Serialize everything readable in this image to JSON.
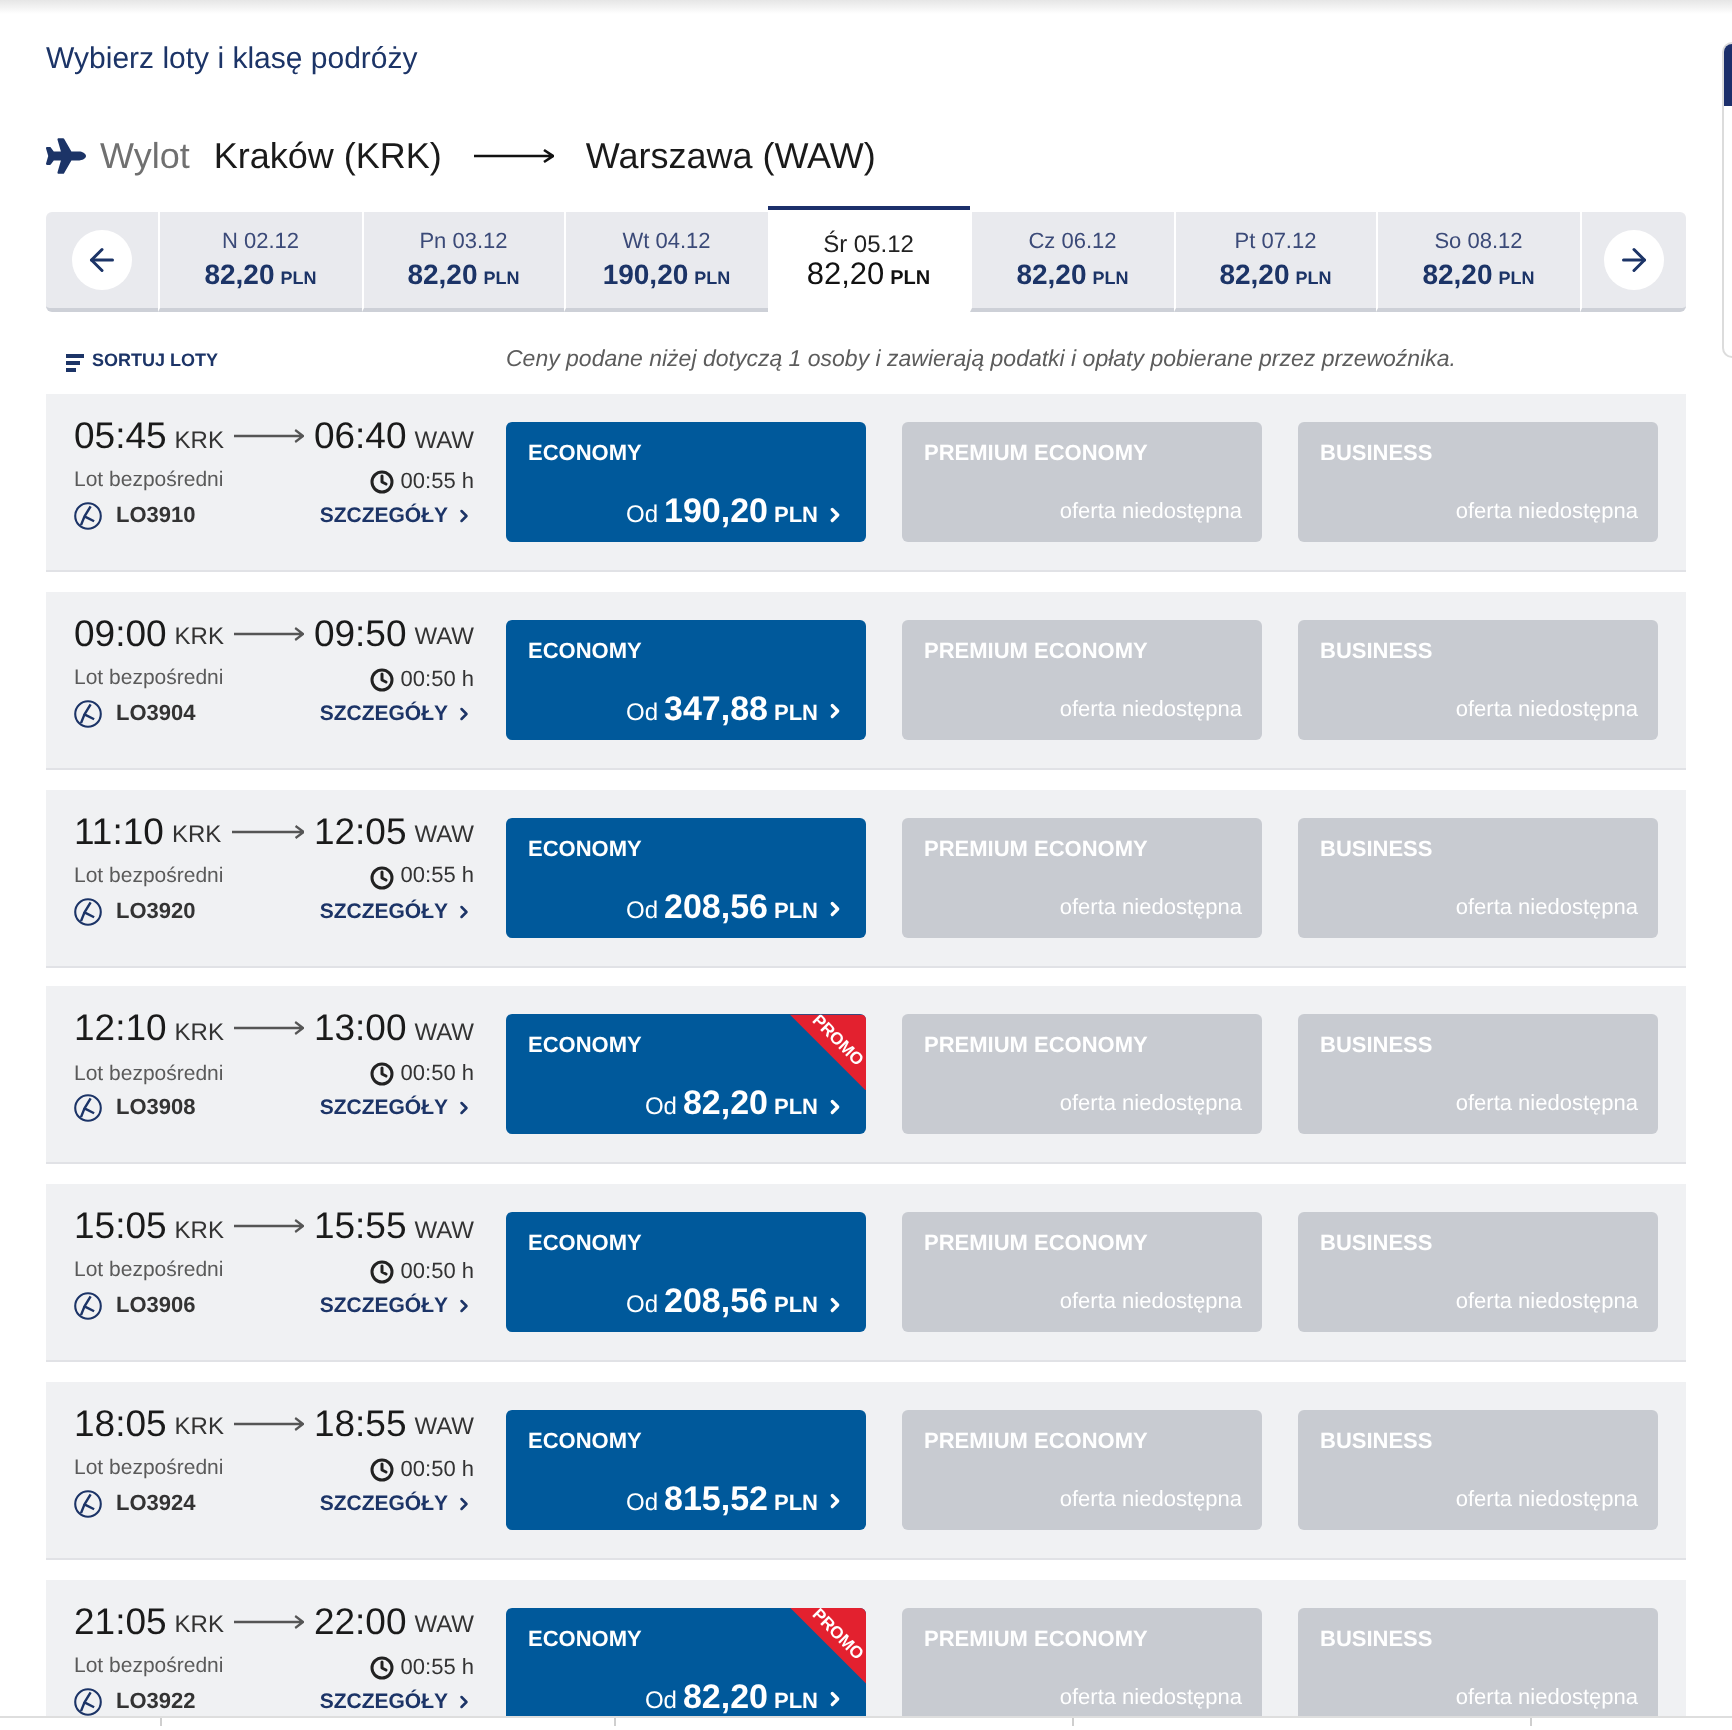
{
  "heading": "Wybierz loty i klasę podróży",
  "route": {
    "label": "Wylot",
    "origin": "Kraków (KRK)",
    "destination": "Warszawa (WAW)"
  },
  "dates": [
    {
      "day": "N 02.12",
      "price": "82,20",
      "currency": "PLN",
      "selected": false
    },
    {
      "day": "Pn 03.12",
      "price": "82,20",
      "currency": "PLN",
      "selected": false
    },
    {
      "day": "Wt 04.12",
      "price": "190,20",
      "currency": "PLN",
      "selected": false
    },
    {
      "day": "Śr 05.12",
      "price": "82,20",
      "currency": "PLN",
      "selected": true
    },
    {
      "day": "Cz 06.12",
      "price": "82,20",
      "currency": "PLN",
      "selected": false
    },
    {
      "day": "Pt 07.12",
      "price": "82,20",
      "currency": "PLN",
      "selected": false
    },
    {
      "day": "So 08.12",
      "price": "82,20",
      "currency": "PLN",
      "selected": false
    }
  ],
  "sort": {
    "label": "SORTUJ LOTY"
  },
  "notice": "Ceny podane niżej dotyczą 1 osoby i zawierają podatki i opłaty pobierane przez przewoźnika.",
  "flights": [
    {
      "departure": "05:45",
      "origin": "KRK",
      "arrival": "06:40",
      "destination": "WAW",
      "type": "Lot bezpośredni",
      "duration": "00:55 h",
      "flight_number": "LO3910",
      "details": "SZCZEGÓŁY",
      "fares": [
        {
          "kind": "available",
          "cabin": "ECONOMY",
          "prefix": "Od",
          "price": "190,20",
          "currency": "PLN"
        },
        {
          "kind": "unavailable",
          "cabin": "PREMIUM ECONOMY",
          "status": "oferta niedostępna"
        },
        {
          "kind": "unavailable",
          "cabin": "BUSINESS",
          "status": "oferta niedostępna"
        }
      ]
    },
    {
      "departure": "09:00",
      "origin": "KRK",
      "arrival": "09:50",
      "destination": "WAW",
      "type": "Lot bezpośredni",
      "duration": "00:50 h",
      "flight_number": "LO3904",
      "details": "SZCZEGÓŁY",
      "fares": [
        {
          "kind": "available",
          "cabin": "ECONOMY",
          "prefix": "Od",
          "price": "347,88",
          "currency": "PLN"
        },
        {
          "kind": "unavailable",
          "cabin": "PREMIUM ECONOMY",
          "status": "oferta niedostępna"
        },
        {
          "kind": "unavailable",
          "cabin": "BUSINESS",
          "status": "oferta niedostępna"
        }
      ]
    },
    {
      "departure": "11:10",
      "origin": "KRK",
      "arrival": "12:05",
      "destination": "WAW",
      "type": "Lot bezpośredni",
      "duration": "00:55 h",
      "flight_number": "LO3920",
      "details": "SZCZEGÓŁY",
      "fares": [
        {
          "kind": "available",
          "cabin": "ECONOMY",
          "prefix": "Od",
          "price": "208,56",
          "currency": "PLN"
        },
        {
          "kind": "unavailable",
          "cabin": "PREMIUM ECONOMY",
          "status": "oferta niedostępna"
        },
        {
          "kind": "unavailable",
          "cabin": "BUSINESS",
          "status": "oferta niedostępna"
        }
      ]
    },
    {
      "departure": "12:10",
      "origin": "KRK",
      "arrival": "13:00",
      "destination": "WAW",
      "type": "Lot bezpośredni",
      "duration": "00:50 h",
      "flight_number": "LO3908",
      "details": "SZCZEGÓŁY",
      "fares": [
        {
          "kind": "available",
          "cabin": "ECONOMY",
          "prefix": "Od",
          "price": "82,20",
          "currency": "PLN",
          "badge": "PROMO"
        },
        {
          "kind": "unavailable",
          "cabin": "PREMIUM ECONOMY",
          "status": "oferta niedostępna"
        },
        {
          "kind": "unavailable",
          "cabin": "BUSINESS",
          "status": "oferta niedostępna"
        }
      ]
    },
    {
      "departure": "15:05",
      "origin": "KRK",
      "arrival": "15:55",
      "destination": "WAW",
      "type": "Lot bezpośredni",
      "duration": "00:50 h",
      "flight_number": "LO3906",
      "details": "SZCZEGÓŁY",
      "fares": [
        {
          "kind": "available",
          "cabin": "ECONOMY",
          "prefix": "Od",
          "price": "208,56",
          "currency": "PLN"
        },
        {
          "kind": "unavailable",
          "cabin": "PREMIUM ECONOMY",
          "status": "oferta niedostępna"
        },
        {
          "kind": "unavailable",
          "cabin": "BUSINESS",
          "status": "oferta niedostępna"
        }
      ]
    },
    {
      "departure": "18:05",
      "origin": "KRK",
      "arrival": "18:55",
      "destination": "WAW",
      "type": "Lot bezpośredni",
      "duration": "00:50 h",
      "flight_number": "LO3924",
      "details": "SZCZEGÓŁY",
      "fares": [
        {
          "kind": "available",
          "cabin": "ECONOMY",
          "prefix": "Od",
          "price": "815,52",
          "currency": "PLN"
        },
        {
          "kind": "unavailable",
          "cabin": "PREMIUM ECONOMY",
          "status": "oferta niedostępna"
        },
        {
          "kind": "unavailable",
          "cabin": "BUSINESS",
          "status": "oferta niedostępna"
        }
      ]
    },
    {
      "departure": "21:05",
      "origin": "KRK",
      "arrival": "22:00",
      "destination": "WAW",
      "type": "Lot bezpośredni",
      "duration": "00:55 h",
      "flight_number": "LO3922",
      "details": "SZCZEGÓŁY",
      "fares": [
        {
          "kind": "available",
          "cabin": "ECONOMY",
          "prefix": "Od",
          "price": "82,20",
          "currency": "PLN",
          "badge": "PROMO"
        },
        {
          "kind": "unavailable",
          "cabin": "PREMIUM ECONOMY",
          "status": "oferta niedostępna"
        },
        {
          "kind": "unavailable",
          "cabin": "BUSINESS",
          "status": "oferta niedostępna"
        }
      ]
    }
  ]
}
